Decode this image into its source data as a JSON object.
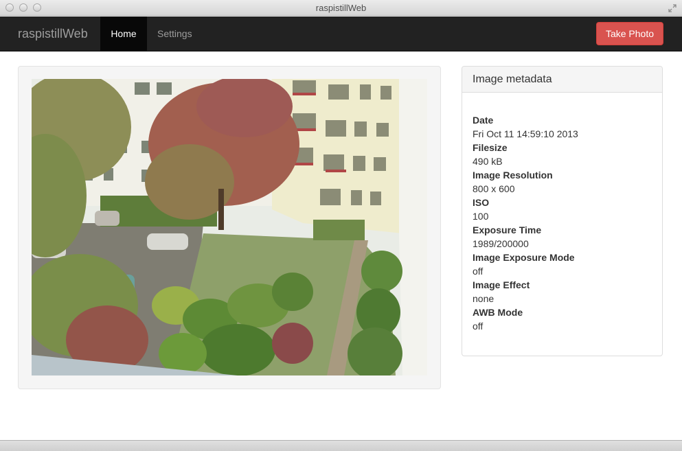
{
  "window": {
    "title": "raspistillWeb"
  },
  "navbar": {
    "brand": "raspistillWeb",
    "items": [
      {
        "label": "Home",
        "active": true
      },
      {
        "label": "Settings",
        "active": false
      }
    ],
    "action_label": "Take Photo",
    "colors": {
      "bar": "#222222",
      "active": "#080808",
      "action": "#d9534f"
    }
  },
  "photo": {
    "icon": "photo-of-apartment-courtyard"
  },
  "metadata": {
    "heading": "Image metadata",
    "items": [
      {
        "label": "Date",
        "value": "Fri Oct 11 14:59:10 2013"
      },
      {
        "label": "Filesize",
        "value": "490 kB"
      },
      {
        "label": "Image Resolution",
        "value": "800 x 600"
      },
      {
        "label": "ISO",
        "value": "100"
      },
      {
        "label": "Exposure Time",
        "value": "1989/200000"
      },
      {
        "label": "Image Exposure Mode",
        "value": "off"
      },
      {
        "label": "Image Effect",
        "value": "none"
      },
      {
        "label": "AWB Mode",
        "value": "off"
      }
    ]
  }
}
